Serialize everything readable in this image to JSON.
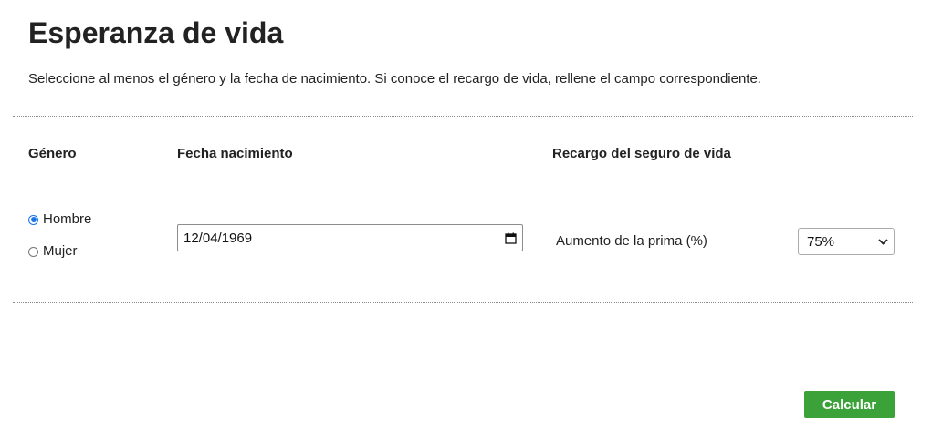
{
  "page": {
    "title": "Esperanza de vida",
    "intro": "Seleccione al menos el género y la fecha de nacimiento. Si conoce el recargo de vida, rellene el campo correspondiente."
  },
  "form": {
    "gender": {
      "heading": "Género",
      "options": [
        {
          "label": "Hombre",
          "checked": true
        },
        {
          "label": "Mujer",
          "checked": false
        }
      ]
    },
    "birthdate": {
      "heading": "Fecha nacimiento",
      "value": "12/04/1969",
      "icon": "calendar-icon"
    },
    "surcharge": {
      "heading": "Recargo del seguro de vida",
      "field_label": "Aumento de la prima (%)",
      "selected": "75%",
      "icon": "chevron-down-icon"
    }
  },
  "actions": {
    "calculate_label": "Calcular",
    "calculate_color": "#3aa238"
  },
  "colors": {
    "radio_accent": "#1a73e8",
    "text": "#222222"
  }
}
